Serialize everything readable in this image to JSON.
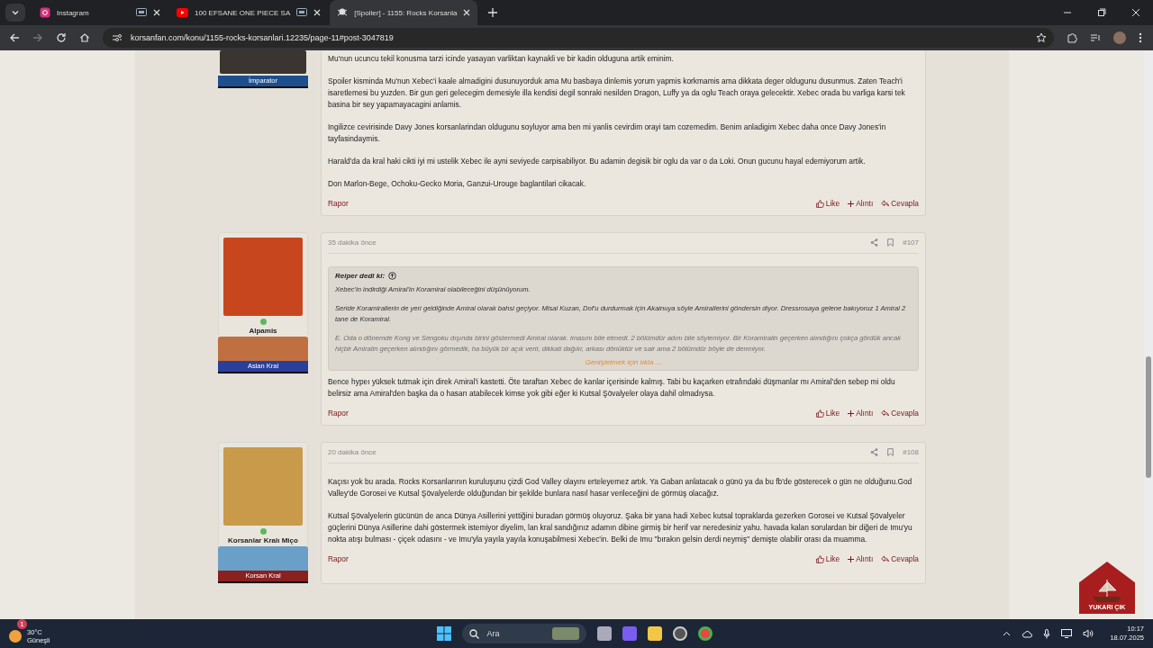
{
  "browser": {
    "tabs": [
      {
        "title": "Instagram",
        "kind": "instagram",
        "casting": true,
        "selected": false
      },
      {
        "title": "100 EFSANE ONE PIECE SA",
        "kind": "video",
        "casting": true,
        "selected": false
      },
      {
        "title": "[Spoiler] - 1155: Rocks Korsanla",
        "kind": "forum",
        "casting": false,
        "selected": true
      }
    ],
    "url": "korsanfan.com/konu/1155-rocks-korsanlari.12235/page-11#post-3047819"
  },
  "posts": [
    {
      "cut_top": true,
      "online": false,
      "badge": {
        "label": "İmparator",
        "color": "#1d4f8f"
      },
      "paragraphs": [
        "Mu'nun ucuncu tekil konusma tarzi icinde yasayan varliktan kaynakli ve bir kadin olduguna artik eminim.",
        "Spoiler kisminda Mu'nun Xebec'i kaale almadigini dusunuyorduk ama Mu basbaya dinlemis yorum yapmis korkmamis ama dikkata deger oldugunu dusunmus. Zaten Teach'i isaretlemesi bu yuzden. Bir gun geri gelecegim demesiyle illa kendisi degil sonraki nesilden Dragon, Luffy ya da oglu Teach oraya gelecektir. Xebec orada bu varliga karsi tek basina bir sey yapamayacagini anlamis.",
        "Ingilizce cevirisinde Davy Jones korsanlarindan oldugunu soyluyor ama ben mi yanlis cevirdim orayi tam cozemedim. Benim anladigim Xebec daha once Davy Jones'in tayfasindaymis.",
        "Harald'da da kral haki cikti iyi mi ustelik Xebec ile ayni seviyede carpisabiliyor. Bu adamin degisik bir oglu da var o da Loki. Onun gucunu hayal edemiyorum artik.",
        "Don Marlon-Bege, Ochoku-Gecko Moria, Ganzui-Urouge baglantilari cikacak."
      ],
      "report": "Rapor",
      "actions": [
        {
          "kind": "like",
          "label": "Like"
        },
        {
          "kind": "quote",
          "label": "Alıntı"
        },
        {
          "kind": "reply",
          "label": "Cevapla"
        }
      ]
    },
    {
      "cut_top": false,
      "online": true,
      "author": "Alpamis",
      "badge": {
        "label": "Aslan Kral",
        "color": "#2a3f9a"
      },
      "time": "35 dakika önce",
      "number": "#107",
      "quote": {
        "author": "Reiper dedi ki:",
        "paragraphs": [
          "Xebec'in indirdiği Amiral'in Koramiral olabileceğini düşünüyorum.",
          "Seride Koramirallerin de yeri geldiğinde Amiral olarak bahsi geçiyor. Misal Kuzan, Dof'u durdurmak için Akainuya söyle Amirallerini göndersin diyor. Dressrosaya gelene bakıyoruz 1 Amiral 2 tane de Koramiral.",
          "E. Oda o dönemde Kong ve Sengoku dışında birini göstermedi Amiral olarak. imasını bile etmedi. 2 bölümdür adını bile söylemiyor. Bir Koramiralin geçerken alındığını çokça gördük ancak hiçbir Amiralin geçerken alındığını görmedik, ha büyük bir açık verir, dikkati dağılır, arkası dönüktür ve sair ama 2 bölümdür böyle de denmiyor."
        ],
        "expand": "Genişletmek için tıkla ..."
      },
      "paragraphs": [
        "Bence hypeı yüksek tutmak için direk Amiral'i kastetti. Öte taraftan Xebec de kanlar içerisinde kalmış. Tabi bu kaçarken etrafındaki düşmanlar mı Amiral'den sebep mi oldu belirsiz ama Amiral'den başka da o hasarı atabilecek kimse yok gibi eğer ki Kutsal Şövalyeler olaya dahil olmadıysa."
      ],
      "report": "Rapor",
      "actions": [
        {
          "kind": "like",
          "label": "Like"
        },
        {
          "kind": "quote",
          "label": "Alıntı"
        },
        {
          "kind": "reply",
          "label": "Cevapla"
        }
      ]
    },
    {
      "cut_top": false,
      "online": true,
      "author": "Korsanlar Kralı Miço",
      "badge": {
        "label": "Korsan Kral",
        "color": "#8a2020"
      },
      "time": "20 dakika önce",
      "number": "#108",
      "paragraphs": [
        "Kaçısı yok bu arada. Rocks Korsanlarının kuruluşunu çizdi God Valley olayını erteleyemez artık. Ya Gaban anlatacak o günü ya da bu fb'de gösterecek o gün ne olduğunu.God Valley'de Gorosei ve Kutsal Şövalyelerde olduğundan bir şekilde bunlara nasıl hasar verileceğini de görmüş olacağız.",
        "Kutsal Şövalyelerin gücünün de anca Dünya Asillerini yettiğini buradan görmüş oluyoruz. Şaka bir yana hadi Xebec kutsal topraklarda gezerken Gorosei ve Kutsal Şövalyeler güçlerini Dünya Asillerine dahi göstermek istemiyor diyelim, lan kral sandığınız adamın dibine girmiş bir herif var neredesiniz yahu. havada kalan sorulardan bir diğeri de Imu'yu nokta atışı bulması - çiçek odasını - ve Imu'yla yayıla yayıla konuşabilmesi Xebec'in. Belki de Imu \"bırakın gelsin derdi neymiş\" demişte olabilir orası da muamma."
      ],
      "report": "Rapor",
      "actions": [
        {
          "kind": "like",
          "label": "Like"
        },
        {
          "kind": "quote",
          "label": "Alıntı"
        },
        {
          "kind": "reply",
          "label": "Cevapla"
        }
      ]
    }
  ],
  "scroll_top": {
    "label": "YUKARI ÇIK"
  },
  "taskbar": {
    "weather": {
      "badge": "1",
      "temp": "30°C",
      "condition": "Güneşli"
    },
    "search_placeholder": "Ara",
    "time": "10:17",
    "date": "18.07.2025"
  }
}
